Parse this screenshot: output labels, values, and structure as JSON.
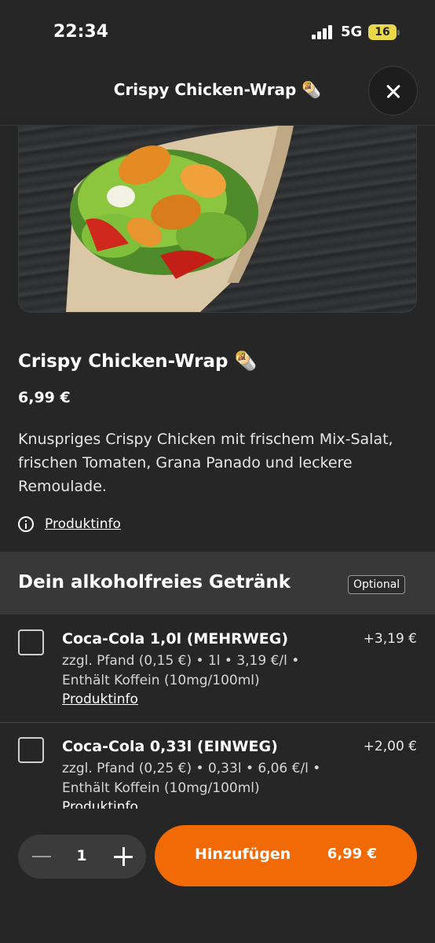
{
  "status": {
    "time": "22:34",
    "network": "5G",
    "battery": "16"
  },
  "header": {
    "title": "Crispy Chicken-Wrap 🌯"
  },
  "product": {
    "name": "Crispy Chicken-Wrap 🌯",
    "price": "6,99 €",
    "description": "Knuspriges Crispy Chicken mit frischem Mix-Salat, frischen Tomaten, Grana Panado und leckere Remoulade.",
    "info_link": "Produktinfo"
  },
  "section": {
    "title": "Dein alkoholfreies Getränk",
    "badge": "Optional"
  },
  "options": [
    {
      "name": "Coca-Cola 1,0l (MEHRWEG)",
      "price": "+3,19 €",
      "detail": "zzgl. Pfand (0,15 €) • 1l • 3,19 €/l • Enthält Koffein (10mg/100ml)",
      "link": "Produktinfo",
      "checked": false
    },
    {
      "name": "Coca-Cola 0,33l (EINWEG)",
      "price": "+2,00 €",
      "detail": "zzgl. Pfand (0,25 €) • 0,33l • 6,06 €/l • Enthält Koffein (10mg/100ml)",
      "link": "Produktinfo",
      "checked": false
    }
  ],
  "cart": {
    "quantity": "1",
    "add_label": "Hinzufügen",
    "total": "6,99 €"
  },
  "colors": {
    "accent": "#f26a05",
    "background": "#262626",
    "section_background": "#383838"
  }
}
